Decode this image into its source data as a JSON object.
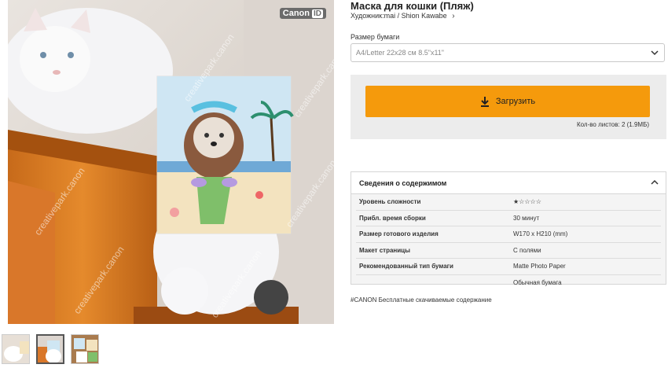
{
  "brand": {
    "name": "Canon",
    "id_label": "ID"
  },
  "product": {
    "title": "Маска для кошки (Пляж)",
    "artist": "Художник:mai / Shion Kawabe",
    "paper_size_label": "Размер бумаги",
    "paper_size_value": "A4/Letter 22x28 см 8.5\"x11\""
  },
  "download": {
    "button_label": "Загрузить",
    "sheets_info": "Кол-во листов: 2 (1.9MБ)"
  },
  "details": {
    "heading": "Сведения о содержимом",
    "rows": [
      {
        "key": "Уровень сложности",
        "value": "★☆☆☆☆"
      },
      {
        "key": "Прибл. время сборки",
        "value": "30 минут"
      },
      {
        "key": "Размер готового изделия",
        "value": "W170 x H210 (mm)"
      },
      {
        "key": "Макет страницы",
        "value": "С полями"
      },
      {
        "key": "Рекомендованный тип бумаги",
        "value": "Matte Photo Paper"
      },
      {
        "key": "",
        "value": "Обычная бумага"
      }
    ]
  },
  "hashtag": "#CANON Бесплатные скачиваемые содержание",
  "watermark": "creativepark.canon",
  "thumbnails": [
    "thumb-1",
    "thumb-2",
    "thumb-3"
  ],
  "selected_thumbnail": 2
}
